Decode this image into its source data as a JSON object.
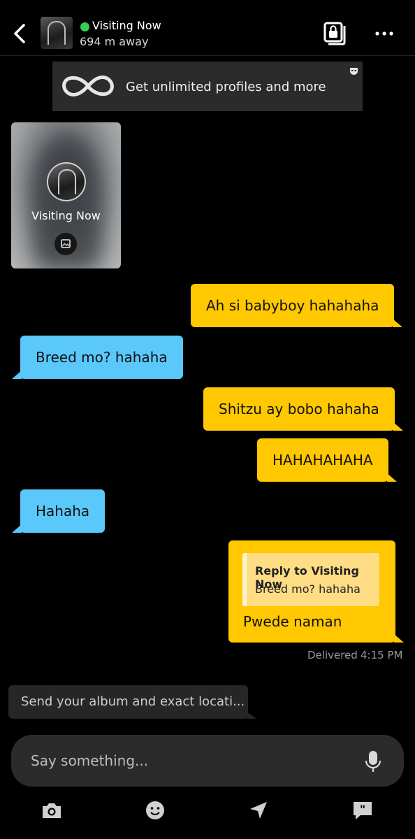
{
  "header": {
    "name": "Visiting Now",
    "distance": "694 m away",
    "back_icon": "chevron-left-icon",
    "album_icon": "private-album-icon",
    "more_icon": "more-horizontal-icon",
    "online_color": "#34d058"
  },
  "promo": {
    "text": "Get unlimited profiles and more",
    "icon": "infinity-icon"
  },
  "profile_card": {
    "label": "Visiting Now",
    "icon": "image-icon"
  },
  "messages": [
    {
      "direction": "out",
      "text": "Ah si babyboy hahahaha"
    },
    {
      "direction": "in",
      "text": "Breed mo? hahaha"
    },
    {
      "direction": "out",
      "text": "Shitzu ay bobo hahaha"
    },
    {
      "direction": "out",
      "text": "HAHAHAHAHA"
    },
    {
      "direction": "in",
      "text": "Hahaha"
    }
  ],
  "reply_message": {
    "quote_title": "Reply to Visiting Now",
    "quote_body": "Breed mo? hahaha",
    "text": "Pwede naman"
  },
  "status": {
    "delivered": "Delivered",
    "time": "4:15 PM"
  },
  "suggestion": {
    "text": "Send your album and exact locati..."
  },
  "composer": {
    "placeholder": "Say something...",
    "mic_icon": "microphone-icon"
  },
  "toolbar": [
    "camera-icon",
    "emoji-icon",
    "location-arrow-icon",
    "quick-replies-icon"
  ],
  "colors": {
    "outgoing": "#ffc800",
    "incoming": "#5ac8fa",
    "background": "#000000"
  }
}
